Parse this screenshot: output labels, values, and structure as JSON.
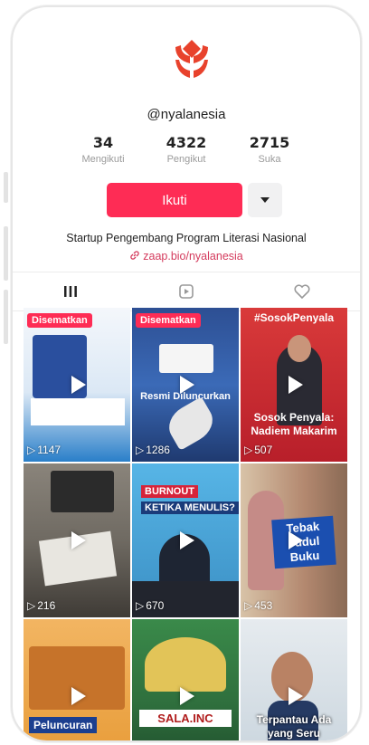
{
  "profile": {
    "handle": "@nyalanesia",
    "brand_color": "#e8422c",
    "stats": [
      {
        "value": "34",
        "label": "Mengikuti"
      },
      {
        "value": "4322",
        "label": "Pengikut"
      },
      {
        "value": "2715",
        "label": "Suka"
      }
    ],
    "follow_label": "Ikuti",
    "bio": "Startup Pengembang Program Literasi Nasional",
    "link": "zaap.bio/nyalanesia"
  },
  "tabs": [
    {
      "icon": "grid-icon"
    },
    {
      "icon": "repost-icon"
    },
    {
      "icon": "liked-heart-icon"
    }
  ],
  "videos": [
    {
      "pinned_label": "Disematkan",
      "views": "1147",
      "bg": "#2a7fc9",
      "icon": "play-icon"
    },
    {
      "pinned_label": "Disematkan",
      "views": "1286",
      "bg": "#2d4f93",
      "caption": "Resmi Diluncurkan",
      "icon": "play-icon"
    },
    {
      "title": "#SosokPenyala",
      "views": "507",
      "bg": "#c62830",
      "caption": "Sosok Penyala: Nadiem Makarim",
      "icon": "play-icon"
    },
    {
      "views": "216",
      "bg": "#6f6a62",
      "icon": "play-icon"
    },
    {
      "views": "670",
      "bg": "#4aa3d8",
      "top_text": "BURNOUT",
      "top_text2": "KETIKA MENULIS?",
      "icon": "play-icon"
    },
    {
      "views": "453",
      "bg": "#b3886f",
      "caption": "Tebak Judul Buku",
      "icon": "play-icon"
    },
    {
      "bg": "#e79a35",
      "caption": "Peluncuran",
      "icon": "play-icon"
    },
    {
      "bg": "#2f6f3d",
      "caption": "SALA.INC",
      "icon": "play-icon"
    },
    {
      "bg": "#c7d3dc",
      "caption": "Terpantau Ada yang Seru",
      "icon": "play-icon"
    }
  ]
}
